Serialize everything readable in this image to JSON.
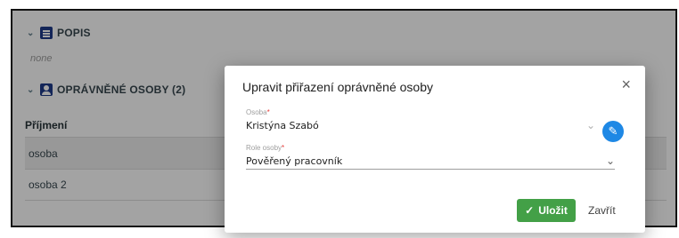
{
  "background": {
    "popis_title": "POPIS",
    "popis_value": "none",
    "persons_title": "OPRÁVNĚNÉ OSOBY (2)",
    "table_header": "Příjmení",
    "rows": [
      "osoba",
      "osoba 2"
    ]
  },
  "dialog": {
    "title": "Upravit přiřazení oprávněné osoby",
    "close_icon": "×",
    "person_label": "Osoba",
    "person_value": "Kristýna Szabó",
    "role_label": "Role osoby",
    "role_value": "Pověřený pracovník",
    "required_mark": "*",
    "dropdown_icon": "⌄",
    "edit_icon": "✎",
    "save_icon": "✓",
    "save_label": "Uložit",
    "cancel_label": "Zavřít"
  },
  "colors": {
    "accent": "#1e88e5",
    "save": "#43a047",
    "section_icon": "#1e3a8a"
  }
}
